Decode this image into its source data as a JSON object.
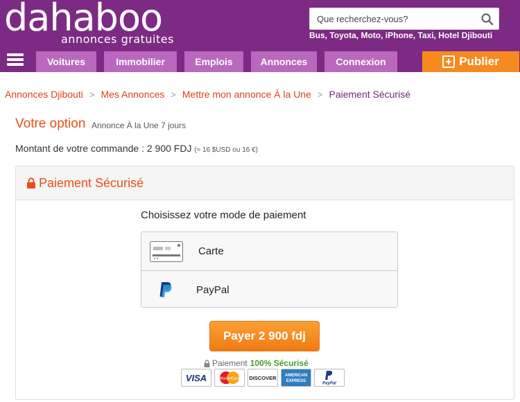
{
  "header": {
    "logo": "dahaboo",
    "tagline": "annonces gratuites",
    "search_placeholder": "Que recherchez-vous?",
    "search_hint": "Bus, Toyota, Moto, iPhone, Taxi, Hotel Djibouti",
    "nav": [
      "Voitures",
      "Immobilier",
      "Emplois",
      "Annonces",
      "Connexion"
    ],
    "publish_label": "Publier",
    "colors": {
      "brand": "#7d2a84",
      "nav_tab": "#b968be",
      "publish": "#f68a1f"
    }
  },
  "breadcrumb": [
    "Annonces Djibouti",
    "Mes Annonces",
    "Mettre mon annonce À la Une",
    "Paiement Sécurisé"
  ],
  "option": {
    "title": "Votre option",
    "subtitle": "Annonce À la Une 7 jours"
  },
  "amount": {
    "label": "Montant de votre commande : 2 900 FDJ",
    "conversion": "(≈ 16 $USD ou 16 €)"
  },
  "panel": {
    "title": "Paiement Sécurisé",
    "choose_label": "Choisissez votre mode de paiement",
    "methods": [
      {
        "label": "Carte",
        "icon": "credit-card-icon"
      },
      {
        "label": "PayPal",
        "icon": "paypal-icon"
      }
    ],
    "pay_button": "Payer 2 900 fdj",
    "secure_prefix": "Paiement",
    "secure_strong": "100% Sécurisé",
    "card_logos": [
      "VISA",
      "MasterCard",
      "DISCOVER",
      "AMERICAN EXPRESS",
      "PayPal"
    ]
  }
}
